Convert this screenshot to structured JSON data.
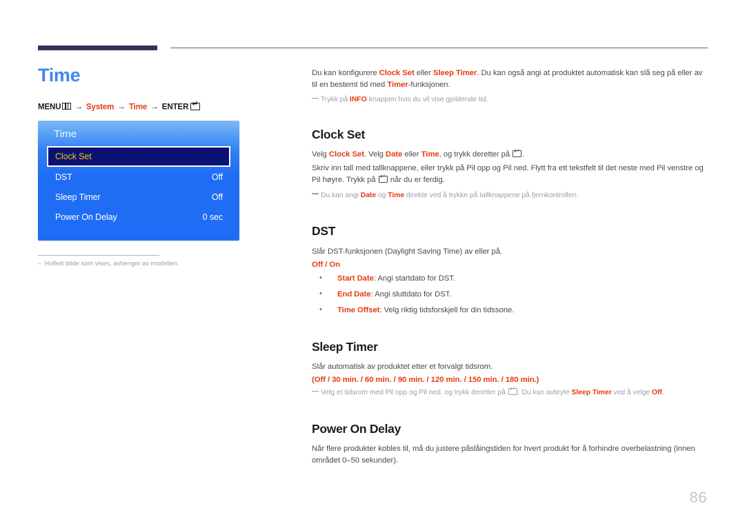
{
  "page": {
    "title": "Time",
    "number": "86",
    "accent_blue": "#4285f4",
    "accent_red": "#e8390f",
    "rule_navy": "#2e3457"
  },
  "menu_path": {
    "menu_label": "MENU",
    "menu_icon": "menu-grid-icon",
    "arrow": "→",
    "step1": "System",
    "step2": "Time",
    "enter_label": "ENTER",
    "enter_icon": "enter-key-icon"
  },
  "osd": {
    "title": "Time",
    "rows": [
      {
        "label": "Clock Set",
        "value": "",
        "selected": true
      },
      {
        "label": "DST",
        "value": "Off",
        "selected": false
      },
      {
        "label": "Sleep Timer",
        "value": "Off",
        "selected": false
      },
      {
        "label": "Power On Delay",
        "value": "0 sec",
        "selected": false
      }
    ]
  },
  "left_note": {
    "dash": "–",
    "text": "Hvilket bilde som vises, avhenger av modellen."
  },
  "intro": {
    "p1_a": "Du kan konfigurere ",
    "p1_hl1": "Clock Set",
    "p1_b": " eller ",
    "p1_hl2": "Sleep Timer",
    "p1_c": ". Du kan også angi at produktet automatisk kan slå seg på eller av til en bestemt tid med ",
    "p1_hl3": "Timer",
    "p1_d": "-funksjonen.",
    "note_a": "Trykk på ",
    "note_hl": "INFO",
    "note_b": "-knappen hvis du vil vise gjeldende tid."
  },
  "sections": {
    "clock_set": {
      "heading": "Clock Set",
      "p1_a": "Velg ",
      "p1_hl1": "Clock Set",
      "p1_b": ". Velg ",
      "p1_hl2": "Date",
      "p1_c": " eller ",
      "p1_hl3": "Time",
      "p1_d": ", og trykk deretter på ",
      "p1_e": ".",
      "p2_a": "Skriv inn tall med tallknappene, eller trykk på Pil opp og Pil ned. Flytt fra ett tekstfelt til det neste med Pil venstre og Pil høyre. Trykk på ",
      "p2_b": " når du er ferdig.",
      "note_a": "Du kan angi ",
      "note_hl1": "Date",
      "note_b": " og ",
      "note_hl2": "Time",
      "note_c": " direkte ved å trykke på tallknappene på fjernkontrollen."
    },
    "dst": {
      "heading": "DST",
      "p1": "Slår DST-funksjonen (Daylight Saving Time) av eller på.",
      "options": "Off / On",
      "bullets": [
        {
          "term": "Start Date",
          "desc": ": Angi startdato for DST."
        },
        {
          "term": "End Date",
          "desc": ": Angi sluttdato for DST."
        },
        {
          "term": "Time Offset",
          "desc": ": Velg riktig tidsforskjell for din tidssone."
        }
      ]
    },
    "sleep_timer": {
      "heading": "Sleep Timer",
      "p1": "Slår automatisk av produktet etter et forvalgt tidsrom.",
      "options": "(Off / 30 min. / 60 min. / 90 min. / 120 min. / 150 min. / 180 min.)",
      "note_a": "Velg et tidsrom med Pil opp og Pil ned, og trykk deretter på ",
      "note_b": ". Du kan avbryte ",
      "note_hl1": "Sleep Timer",
      "note_c": " ved å velge ",
      "note_hl2": "Off",
      "note_d": "."
    },
    "power_on_delay": {
      "heading": "Power On Delay",
      "p1": "Når flere produkter kobles til, må du justere påslåingstiden for hvert produkt for å forhindre overbelastning (innen området 0–50 sekunder)."
    }
  }
}
